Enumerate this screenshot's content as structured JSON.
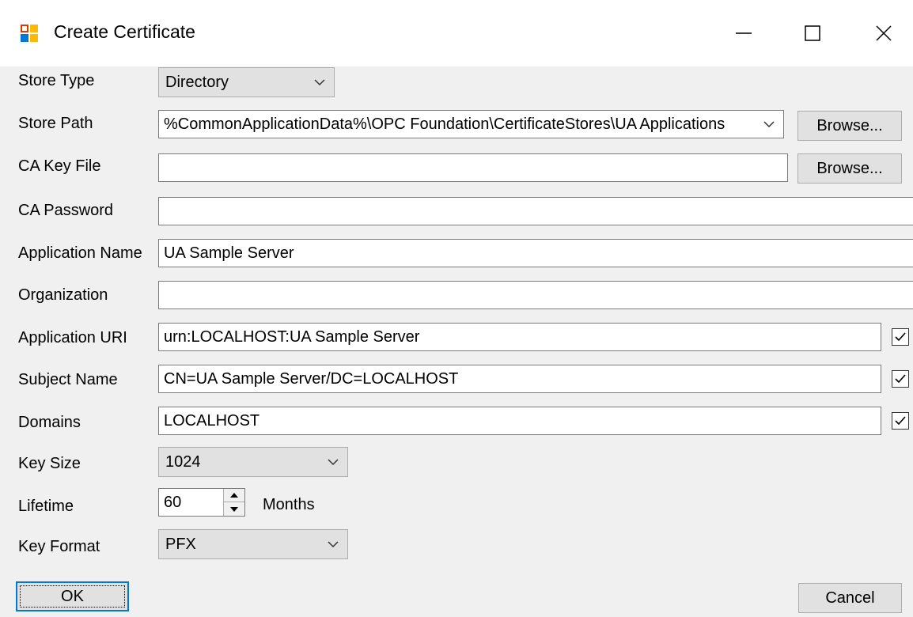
{
  "window": {
    "title": "Create Certificate"
  },
  "labels": {
    "store_type": "Store Type",
    "store_path": "Store Path",
    "ca_key_file": "CA Key File",
    "ca_password": "CA Password",
    "application_name": "Application Name",
    "organization": "Organization",
    "application_uri": "Application URI",
    "subject_name": "Subject Name",
    "domains": "Domains",
    "key_size": "Key Size",
    "lifetime": "Lifetime",
    "lifetime_unit": "Months",
    "key_format": "Key Format"
  },
  "fields": {
    "store_type": "Directory",
    "store_path": "%CommonApplicationData%\\OPC Foundation\\CertificateStores\\UA Applications",
    "ca_key_file": "",
    "ca_password": "",
    "application_name": "UA Sample Server",
    "organization": "",
    "application_uri": "urn:LOCALHOST:UA Sample Server",
    "subject_name": "CN=UA Sample Server/DC=LOCALHOST",
    "domains": "LOCALHOST",
    "key_size": "1024",
    "lifetime": "60",
    "key_format": "PFX"
  },
  "checkboxes": {
    "application_uri_checked": true,
    "subject_name_checked": true,
    "domains_checked": true
  },
  "buttons": {
    "browse_store": "Browse...",
    "browse_ca_key": "Browse...",
    "ok": "OK",
    "cancel": "Cancel"
  },
  "icons": {
    "app": "certificate-app-icon",
    "minimize": "minimize-icon",
    "maximize": "maximize-icon",
    "close": "close-icon",
    "dropdown": "chevron-down-icon",
    "checkmark": "checkmark-icon"
  }
}
